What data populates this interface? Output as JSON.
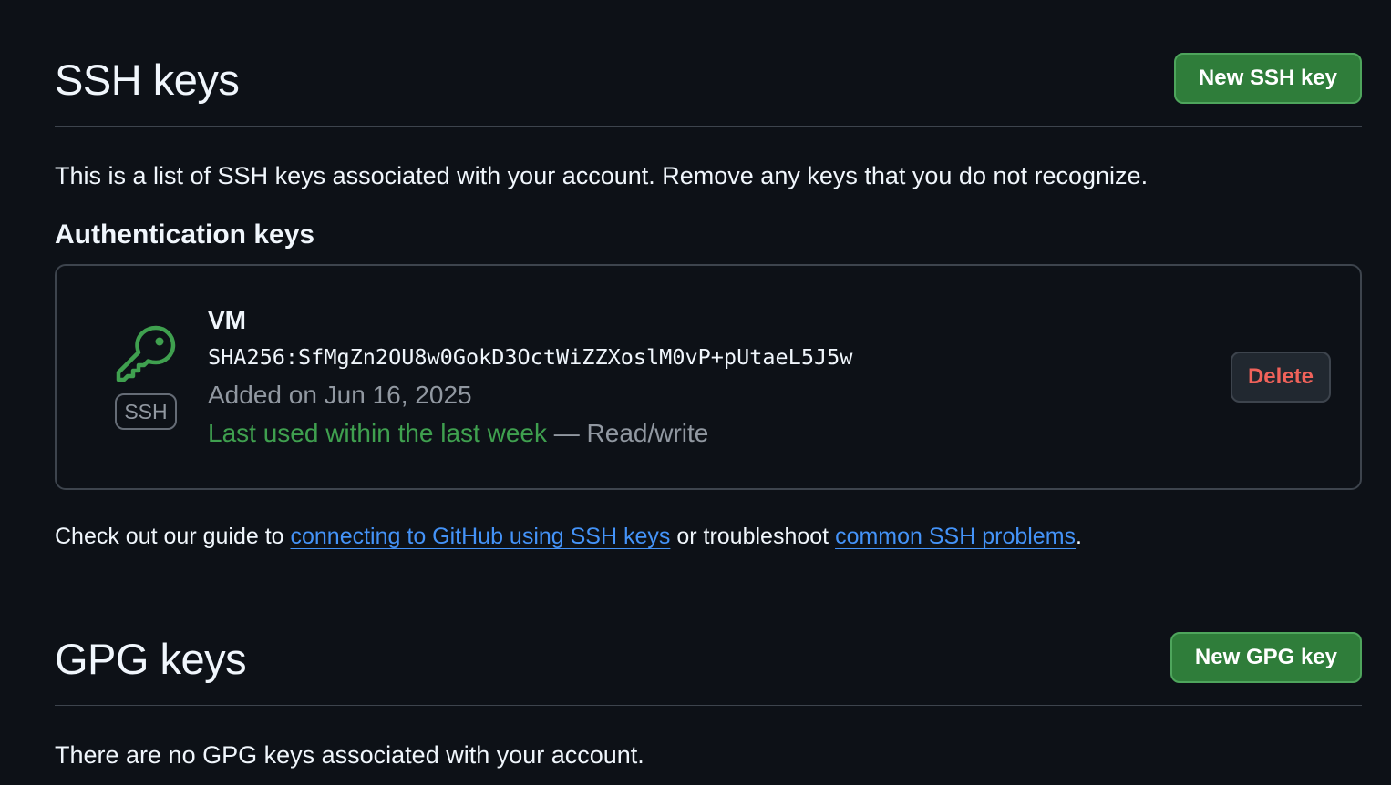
{
  "ssh_section": {
    "title": "SSH keys",
    "new_button": "New SSH key",
    "description": "This is a list of SSH keys associated with your account. Remove any keys that you do not recognize.",
    "subheading": "Authentication keys",
    "keys": [
      {
        "badge": "SSH",
        "icon": "key-icon",
        "title": "VM",
        "fingerprint": "SHA256:SfMgZn2OU8w0GokD3OctWiZZXoslM0vP+pUtaeL5J5w",
        "added": "Added on Jun 16, 2025",
        "last_used": "Last used within the last week",
        "access": " — Read/write",
        "delete_label": "Delete"
      }
    ],
    "guide": {
      "prefix": "Check out our guide to ",
      "link1": "connecting to GitHub using SSH keys",
      "middle": " or troubleshoot ",
      "link2": "common SSH problems",
      "suffix": "."
    }
  },
  "gpg_section": {
    "title": "GPG keys",
    "new_button": "New GPG key",
    "empty_message": "There are no GPG keys associated with your account."
  },
  "colors": {
    "background": "#0d1117",
    "primary_button": "#2f7d3a",
    "danger_text": "#f0625a",
    "success_text": "#3fa04f",
    "link": "#4493f8"
  }
}
